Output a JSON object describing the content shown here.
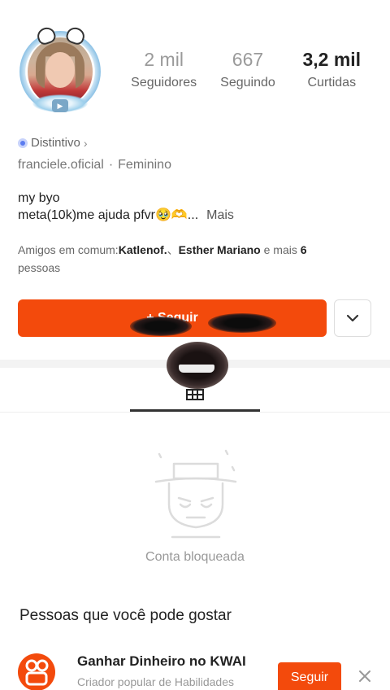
{
  "profile": {
    "stats": [
      {
        "value": "2 mil",
        "label": "Seguidores"
      },
      {
        "value": "667",
        "label": "Seguindo"
      },
      {
        "value": "3,2 mil",
        "label": "Curtidas"
      }
    ],
    "badge_label": "Distintivo",
    "username": "franciele.oficial",
    "separator": "·",
    "gender": "Feminino",
    "bio_line1": "my byo",
    "bio_line2": "meta(10k)me ajuda pfvr🥹🫶...",
    "bio_more": "Mais",
    "mutual_prefix": "Amigos em comum:",
    "mutual_name1": "Katlenof.",
    "mutual_sep": "、",
    "mutual_name2": "Esther Mariano",
    "mutual_and_more": " e mais ",
    "mutual_count": "6",
    "mutual_suffix": "pessoas",
    "follow_label": "+ Seguir"
  },
  "blocked": {
    "text": "Conta bloqueada"
  },
  "suggestions": {
    "title": "Pessoas que você pode gostar",
    "items": [
      {
        "name": "Ganhar Dinheiro no KWAI",
        "subtitle": "Criador popular de Habilidades",
        "follow_label": "Seguir"
      }
    ]
  },
  "colors": {
    "accent": "#f34a0c",
    "badge": "#5b7cf0"
  },
  "icons": [
    "chevron-right-icon",
    "chevron-down-icon",
    "grid-icon",
    "close-icon",
    "blocked-user-icon"
  ]
}
